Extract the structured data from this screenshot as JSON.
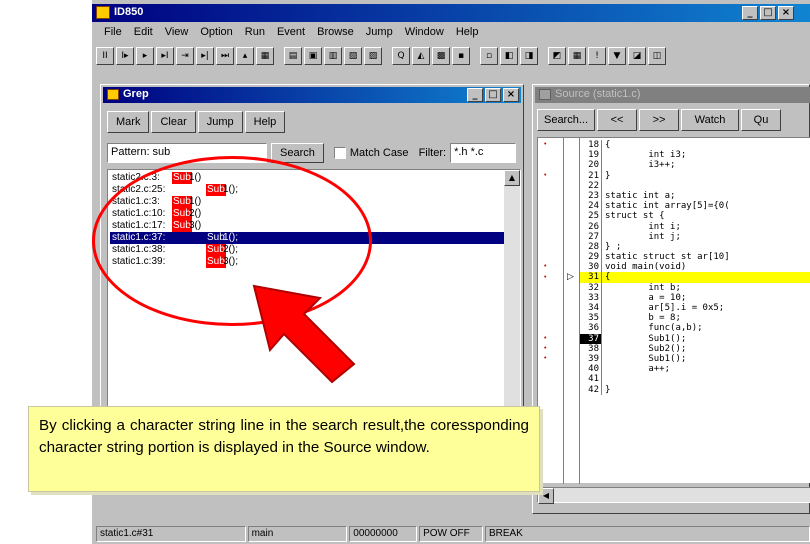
{
  "app": {
    "title": "ID850",
    "caption_buttons": [
      "_",
      "□",
      "×"
    ]
  },
  "menu": [
    "File",
    "Edit",
    "View",
    "Option",
    "Run",
    "Event",
    "Browse",
    "Jump",
    "Window",
    "Help"
  ],
  "toolbar": {
    "buttons": [
      "II",
      "I▸",
      "▸",
      "▸I",
      "⇥",
      "▸|",
      "⏭",
      "▴",
      "▦",
      "▤",
      "▣",
      "▥",
      "▧",
      "▨",
      "Q",
      "◭",
      "▩",
      "▪",
      "▫",
      "◧",
      "◨",
      "◩",
      "▦",
      "!",
      "▼",
      "◪",
      "◫"
    ]
  },
  "grep": {
    "title": "Grep",
    "buttons": [
      "Mark",
      "Clear",
      "Jump",
      "Help"
    ],
    "pattern_label": "Pattern:",
    "pattern_value": "sub",
    "search_button": "Search",
    "match_case_label": "Match Case",
    "filter_label": "Filter:",
    "filter_value": "*.h *.c",
    "results": [
      {
        "file": "static2.c:3:",
        "match": "Sub",
        "rest": "1()"
      },
      {
        "file": "static2.c:25:",
        "match": "Sub",
        "rest": "1();"
      },
      {
        "file": "static1.c:3:",
        "match": "Sub",
        "rest": "1()"
      },
      {
        "file": "static1.c:10:",
        "match": "Sub",
        "rest": "2()"
      },
      {
        "file": "static1.c:17:",
        "match": "Sub",
        "rest": "3()"
      },
      {
        "file": "static1.c:37:",
        "match": "Sub",
        "rest": "1();"
      },
      {
        "file": "static1.c:38:",
        "match": "Sub",
        "rest": "2();"
      },
      {
        "file": "static1.c:39:",
        "match": "Sub",
        "rest": "3();"
      }
    ],
    "selected_index": 5
  },
  "source": {
    "title": "Source (static1.c)",
    "buttons": [
      "Search...",
      "<<",
      ">>",
      "Watch",
      "Qu"
    ],
    "lines": [
      {
        "n": "18",
        "code": "{"
      },
      {
        "n": "19",
        "code": "        int i3;"
      },
      {
        "n": "20",
        "code": "        i3++;"
      },
      {
        "n": "21",
        "code": "}"
      },
      {
        "n": "22",
        "code": ""
      },
      {
        "n": "23",
        "code": "static int a;"
      },
      {
        "n": "24",
        "code": "static int array[5]={0("
      },
      {
        "n": "25",
        "code": "struct st {"
      },
      {
        "n": "26",
        "code": "        int i;"
      },
      {
        "n": "27",
        "code": "        int j;"
      },
      {
        "n": "28",
        "code": "} ;"
      },
      {
        "n": "29",
        "code": "static struct st ar[10]"
      },
      {
        "n": "30",
        "code": "void main(void)"
      },
      {
        "n": "31",
        "code": "{"
      },
      {
        "n": "32",
        "code": "        int b;"
      },
      {
        "n": "33",
        "code": "        a = 10;"
      },
      {
        "n": "34",
        "code": "        ar[5].i = 0x5;"
      },
      {
        "n": "35",
        "code": "        b = 8;"
      },
      {
        "n": "36",
        "code": "        func(a,b);"
      },
      {
        "n": "37",
        "code": "        Sub1();"
      },
      {
        "n": "38",
        "code": "        Sub2();"
      },
      {
        "n": "39",
        "code": "        Sub1();"
      },
      {
        "n": "40",
        "code": "        a++;"
      },
      {
        "n": "41",
        "code": ""
      },
      {
        "n": "42",
        "code": "}"
      }
    ],
    "current_line": "31",
    "break_line": "37"
  },
  "statusbar": [
    "static1.c#31",
    "main",
    "00000000",
    "POW OFF",
    "BREAK"
  ],
  "callout": {
    "text": "By clicking a character string line in the search result,the coressponding character string portion is displayed in the Source window."
  },
  "colors": {
    "titlebar": "#000080",
    "highlight": "#ff0000",
    "selection": "#000080",
    "current_line": "#ffff00",
    "callout_bg": "#ffff99",
    "annotation": "#ff0000"
  }
}
